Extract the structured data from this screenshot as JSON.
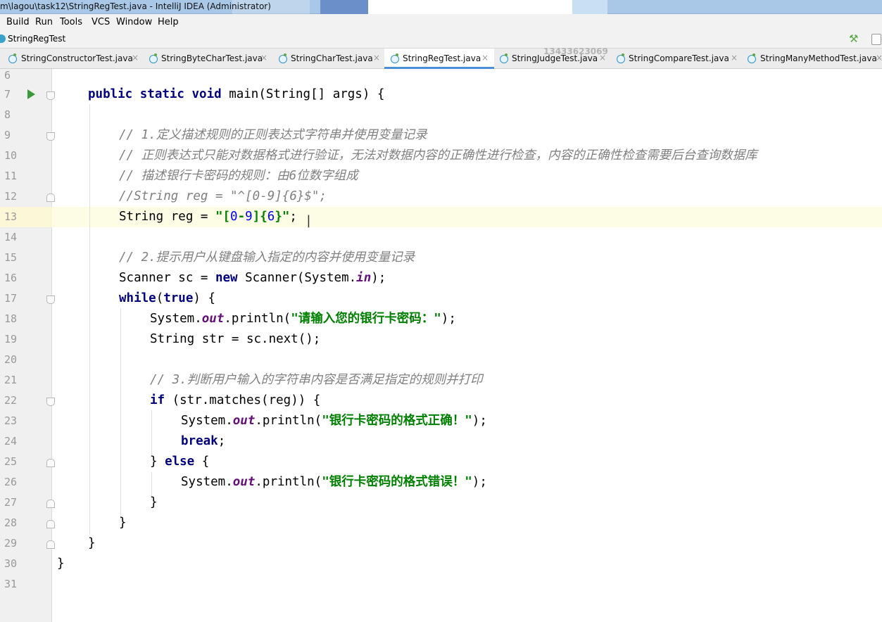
{
  "window": {
    "title": "m\\lagou\\task12\\StringRegTest.java - IntelliJ IDEA (Administrator)"
  },
  "menu": {
    "items": [
      {
        "label": "Build"
      },
      {
        "label": "Run"
      },
      {
        "label": "Tools"
      },
      {
        "label": "VCS"
      },
      {
        "label": "Window"
      },
      {
        "label": "Help"
      }
    ]
  },
  "navbar": {
    "breadcrumb": "StringRegTest"
  },
  "watermark": "13433623069",
  "tabs": [
    {
      "label": "StringConstructorTest.java",
      "active": false
    },
    {
      "label": "StringByteCharTest.java",
      "active": false
    },
    {
      "label": "StringCharTest.java",
      "active": false
    },
    {
      "label": "StringRegTest.java",
      "active": true
    },
    {
      "label": "StringJudgeTest.java",
      "active": false
    },
    {
      "label": "StringCompareTest.java",
      "active": false
    },
    {
      "label": "StringManyMethodTest.java",
      "active": false
    }
  ],
  "tab_close": "×",
  "editor": {
    "line_numbers": [
      "6",
      "7",
      "8",
      "9",
      "10",
      "11",
      "12",
      "13",
      "14",
      "15",
      "16",
      "17",
      "18",
      "19",
      "20",
      "21",
      "22",
      "23",
      "24",
      "25",
      "26",
      "27",
      "28",
      "29",
      "30",
      "31"
    ],
    "code": {
      "l7": {
        "kw1": "public static void",
        "rest": " main(String[] args) {"
      },
      "l9": "// 1.定义描述规则的正则表达式字符串并使用变量记录",
      "l10": "// 正则表达式只能对数据格式进行验证，无法对数据内容的正确性进行检查，内容的正确性检查需要后台查询数据库",
      "l11": "// 描述银行卡密码的规则：由6位数字组成",
      "l12": "//String reg = \"^[0-9]{6}$\";",
      "l13": {
        "pre": "String reg = ",
        "s1": "\"[",
        "n1": "0",
        "s2": "-",
        "n2": "9",
        "s3": "]{",
        "n3": "6",
        "s4": "}\"",
        "post": ";"
      },
      "l15": "// 2.提示用户从键盘输入指定的内容并使用变量记录",
      "l16": {
        "pre": "Scanner sc = ",
        "kw": "new",
        "mid": " Scanner(System.",
        "fld": "in",
        "post": ");"
      },
      "l17": {
        "kw1": "while",
        "p1": "(",
        "kw2": "true",
        "p2": ") {"
      },
      "l18": {
        "pre": "System.",
        "fld": "out",
        "mid": ".println(",
        "str": "\"请输入您的银行卡密码：\"",
        "post": ");"
      },
      "l19": "String str = sc.next();",
      "l21": "// 3.判断用户输入的字符串内容是否满足指定的规则并打印",
      "l22": {
        "kw": "if",
        "rest": " (str.matches(reg)) {"
      },
      "l23": {
        "pre": "System.",
        "fld": "out",
        "mid": ".println(",
        "str": "\"银行卡密码的格式正确！\"",
        "post": ");"
      },
      "l24": {
        "kw": "break",
        "post": ";"
      },
      "l25": {
        "pre": "} ",
        "kw": "else",
        "post": " {"
      },
      "l26": {
        "pre": "System.",
        "fld": "out",
        "mid": ".println(",
        "str": "\"银行卡密码的格式错误！\"",
        "post": ");"
      },
      "l27": "}",
      "l28": "}",
      "l29": "}",
      "l30": "}"
    }
  }
}
